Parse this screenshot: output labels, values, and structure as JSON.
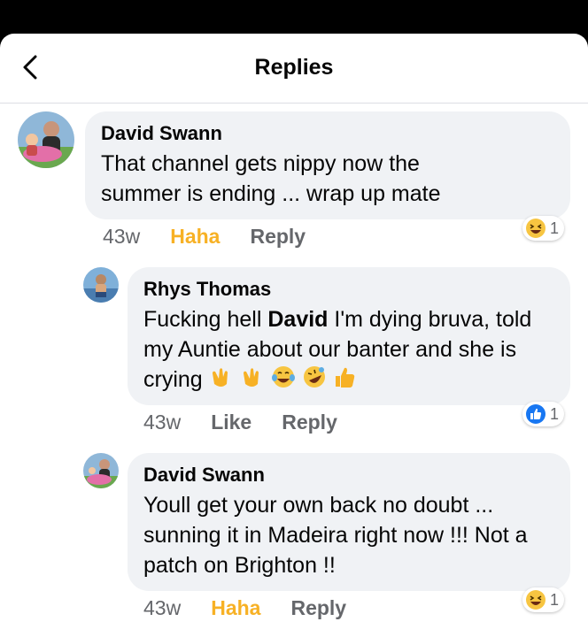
{
  "header": {
    "title": "Replies"
  },
  "comments": [
    {
      "author": "David Swann",
      "text": "That channel gets nippy now the summer is ending ... wrap up mate",
      "time": "43w",
      "action1": "Haha",
      "action2": "Reply",
      "reaction": {
        "icon": "haha-icon",
        "count": "1"
      }
    },
    {
      "author": "Rhys Thomas",
      "text_before": "Fucking hell ",
      "mention": "David",
      "text_after": " I'm dying bruva, told my Auntie about our banter and she is crying",
      "emojis": [
        "clapping-hands-icon",
        "clapping-hands-icon",
        "tears-of-joy-icon",
        "rolling-laughing-icon",
        "thumbs-up-icon"
      ],
      "time": "43w",
      "action1": "Like",
      "action2": "Reply",
      "reaction": {
        "icon": "like-icon",
        "count": "1"
      }
    },
    {
      "author": "David Swann",
      "text": "Youll get your own back no doubt ... sunning it in Madeira right now !!! Not a patch on Brighton !!",
      "time": "43w",
      "action1": "Haha",
      "action2": "Reply",
      "reaction": {
        "icon": "haha-icon",
        "count": "1"
      }
    }
  ],
  "colors": {
    "haha": "#f7b125",
    "like": "#1877f2",
    "bubble": "#f0f2f5",
    "meta": "#65676b"
  }
}
